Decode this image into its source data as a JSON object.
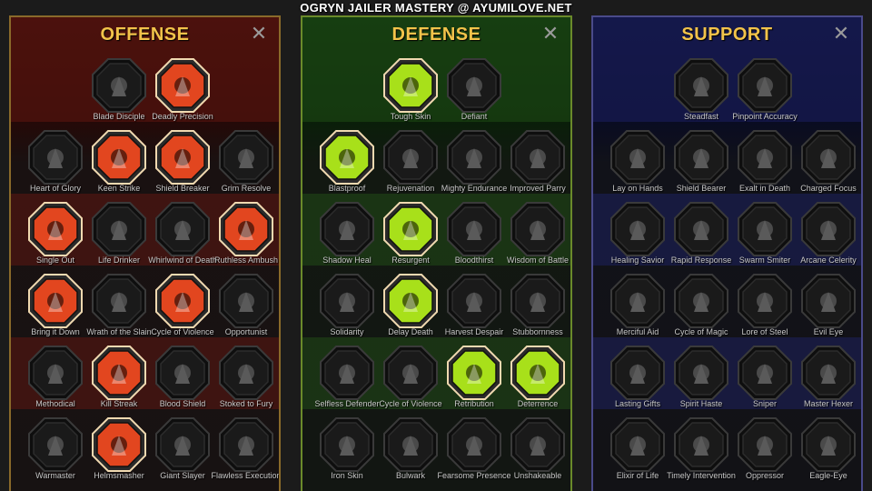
{
  "banner": "OGRYN JAILER MASTERY @ AYUMILOVE.NET",
  "colors": {
    "offense_title": "#f2c34a",
    "active_offense": "#e2461f",
    "active_defense": "#a8e01a",
    "inactive": "#1a1a1a"
  },
  "panels": [
    {
      "id": "offense",
      "title": "OFFENSE",
      "rows": [
        [
          {
            "label": "Blade Disciple",
            "active": false,
            "icon": "crossed-swords-icon"
          },
          {
            "label": "Deadly Precision",
            "active": true,
            "icon": "dagger-icon"
          }
        ],
        [
          {
            "label": "Heart of Glory",
            "active": false,
            "icon": "horned-warrior-icon"
          },
          {
            "label": "Keen Strike",
            "active": true,
            "icon": "slash-icon"
          },
          {
            "label": "Shield Breaker",
            "active": true,
            "icon": "broken-shield-icon"
          },
          {
            "label": "Grim Resolve",
            "active": false,
            "icon": "heart-thorns-icon"
          }
        ],
        [
          {
            "label": "Single Out",
            "active": true,
            "icon": "arrows-icon"
          },
          {
            "label": "Life Drinker",
            "active": false,
            "icon": "fangs-icon"
          },
          {
            "label": "Whirlwind of Death",
            "active": false,
            "icon": "whirlwind-icon"
          },
          {
            "label": "Ruthless Ambush",
            "active": true,
            "icon": "fist-blade-icon"
          }
        ],
        [
          {
            "label": "Bring it Down",
            "active": true,
            "icon": "sword-down-icon"
          },
          {
            "label": "Wrath of the Slain",
            "active": false,
            "icon": "hammer-fist-icon"
          },
          {
            "label": "Cycle of Violence",
            "active": true,
            "icon": "axe-icon"
          },
          {
            "label": "Opportunist",
            "active": false,
            "icon": "chain-lightning-icon"
          }
        ],
        [
          {
            "label": "Methodical",
            "active": false,
            "icon": "spider-icon"
          },
          {
            "label": "Kill Streak",
            "active": true,
            "icon": "skull-icon"
          },
          {
            "label": "Blood Shield",
            "active": false,
            "icon": "shield-icon"
          },
          {
            "label": "Stoked to Fury",
            "active": false,
            "icon": "raging-figure-icon"
          }
        ],
        [
          {
            "label": "Warmaster",
            "active": false,
            "icon": "sword-sparks-icon"
          },
          {
            "label": "Helmsmasher",
            "active": true,
            "icon": "helmet-icon"
          },
          {
            "label": "Giant Slayer",
            "active": false,
            "icon": "giant-icon"
          },
          {
            "label": "Flawless Execution",
            "active": false,
            "icon": "skull-sword-icon"
          }
        ]
      ]
    },
    {
      "id": "defense",
      "title": "DEFENSE",
      "rows": [
        [
          {
            "label": "Tough Skin",
            "active": true,
            "icon": "armor-plates-icon"
          },
          {
            "label": "Defiant",
            "active": false,
            "icon": "raised-fist-icon"
          }
        ],
        [
          {
            "label": "Blastproof",
            "active": true,
            "icon": "chevron-shield-icon"
          },
          {
            "label": "Rejuvenation",
            "active": false,
            "icon": "hand-heart-icon"
          },
          {
            "label": "Mighty Endurance",
            "active": false,
            "icon": "muscle-icon"
          },
          {
            "label": "Improved Parry",
            "active": false,
            "icon": "blades-icon"
          }
        ],
        [
          {
            "label": "Shadow Heal",
            "active": false,
            "icon": "shadow-figure-icon"
          },
          {
            "label": "Resurgent",
            "active": true,
            "icon": "knight-shield-icon"
          },
          {
            "label": "Bloodthirst",
            "active": false,
            "icon": "heart-skull-icon"
          },
          {
            "label": "Wisdom of Battle",
            "active": false,
            "icon": "sage-icon"
          }
        ],
        [
          {
            "label": "Solidarity",
            "active": false,
            "icon": "group-icon"
          },
          {
            "label": "Delay Death",
            "active": true,
            "icon": "hourglass-icon"
          },
          {
            "label": "Harvest Despair",
            "active": false,
            "icon": "open-hand-icon"
          },
          {
            "label": "Stubbornness",
            "active": false,
            "icon": "bull-icon"
          }
        ],
        [
          {
            "label": "Selfless Defender",
            "active": false,
            "icon": "runner-icon"
          },
          {
            "label": "Cycle of Violence",
            "active": false,
            "icon": "drops-icon"
          },
          {
            "label": "Retribution",
            "active": true,
            "icon": "sun-skull-icon"
          },
          {
            "label": "Deterrence",
            "active": true,
            "icon": "deflect-icon"
          }
        ],
        [
          {
            "label": "Iron Skin",
            "active": false,
            "icon": "iron-giant-icon"
          },
          {
            "label": "Bulwark",
            "active": false,
            "icon": "bulwark-shield-icon"
          },
          {
            "label": "Fearsome Presence",
            "active": false,
            "icon": "screaming-face-icon"
          },
          {
            "label": "Unshakeable",
            "active": false,
            "icon": "strongman-icon"
          }
        ]
      ]
    },
    {
      "id": "support",
      "title": "SUPPORT",
      "rows": [
        [
          {
            "label": "Steadfast",
            "active": false,
            "icon": "hands-heart-icon"
          },
          {
            "label": "Pinpoint Accuracy",
            "active": false,
            "icon": "target-swirl-icon"
          }
        ],
        [
          {
            "label": "Lay on Hands",
            "active": false,
            "icon": "praying-hands-icon"
          },
          {
            "label": "Shield Bearer",
            "active": false,
            "icon": "shield-wave-icon"
          },
          {
            "label": "Exalt in Death",
            "active": false,
            "icon": "flaming-skull-icon"
          },
          {
            "label": "Charged Focus",
            "active": false,
            "icon": "energy-hand-icon"
          }
        ],
        [
          {
            "label": "Healing Savior",
            "active": false,
            "icon": "sparkle-figure-icon"
          },
          {
            "label": "Rapid Response",
            "active": false,
            "icon": "lightning-shield-icon"
          },
          {
            "label": "Swarm Smiter",
            "active": false,
            "icon": "swarm-icon"
          },
          {
            "label": "Arcane Celerity",
            "active": false,
            "icon": "arcane-figure-icon"
          }
        ],
        [
          {
            "label": "Merciful Aid",
            "active": false,
            "icon": "chained-heart-icon"
          },
          {
            "label": "Cycle of Magic",
            "active": false,
            "icon": "comet-icon"
          },
          {
            "label": "Lore of Steel",
            "active": false,
            "icon": "book-icon"
          },
          {
            "label": "Evil Eye",
            "active": false,
            "icon": "burst-eye-icon"
          }
        ],
        [
          {
            "label": "Lasting Gifts",
            "active": false,
            "icon": "compass-star-icon"
          },
          {
            "label": "Spirit Haste",
            "active": false,
            "icon": "wind-boot-icon"
          },
          {
            "label": "Sniper",
            "active": false,
            "icon": "eye-icon"
          },
          {
            "label": "Master Hexer",
            "active": false,
            "icon": "hex-doll-icon"
          }
        ],
        [
          {
            "label": "Elixir of Life",
            "active": false,
            "icon": "potion-icon"
          },
          {
            "label": "Timely Intervention",
            "active": false,
            "icon": "skull-clock-icon"
          },
          {
            "label": "Oppressor",
            "active": false,
            "icon": "gauntlet-icon"
          },
          {
            "label": "Eagle-Eye",
            "active": false,
            "icon": "eagle-icon"
          }
        ]
      ]
    }
  ]
}
